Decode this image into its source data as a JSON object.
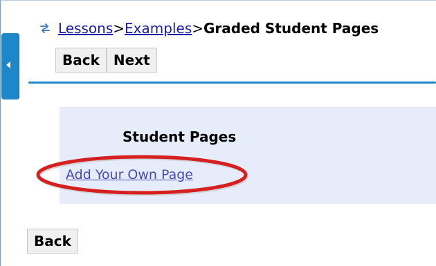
{
  "breadcrumb": {
    "icon": "refresh-icon",
    "links": [
      "Lessons",
      "Examples"
    ],
    "separator": ">",
    "current": "Graded Student Pages"
  },
  "nav": {
    "back_label": "Back",
    "next_label": "Next"
  },
  "panel": {
    "title": "Student Pages",
    "add_link": "Add Your Own Page"
  },
  "footer": {
    "back_label": "Back"
  },
  "colors": {
    "accent": "#1f86c4",
    "panel_bg": "#e6ecfa",
    "link": "#1a1aa6",
    "highlight": "#d62020"
  }
}
